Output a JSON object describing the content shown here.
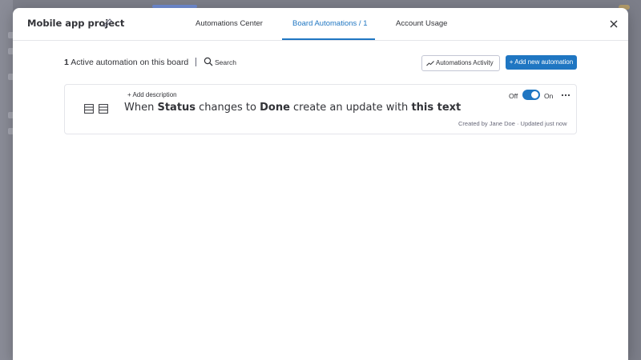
{
  "window": {
    "title": "Mobile app project"
  },
  "tabs": [
    {
      "label": "Automations Center",
      "active": false
    },
    {
      "label": "Board Automations / 1",
      "active": true
    },
    {
      "label": "Account Usage",
      "active": false
    }
  ],
  "toolbar": {
    "count": "1",
    "count_suffix": "Active automation on this board",
    "search_label": "Search",
    "activity_label": "Automations Activity",
    "add_label": "+ Add new automation"
  },
  "automation": {
    "add_description": "+ Add description",
    "sentence": [
      {
        "text": "When ",
        "strong": false
      },
      {
        "text": "Status",
        "strong": true
      },
      {
        "text": " changes to ",
        "strong": false
      },
      {
        "text": "Done",
        "strong": true
      },
      {
        "text": " create an update with ",
        "strong": false
      },
      {
        "text": "this text",
        "strong": true
      }
    ],
    "toggle_off_label": "Off",
    "toggle_on_label": "On",
    "toggle_state": "on",
    "meta": "Created by Jane Doe · Updated just now",
    "icons": [
      "board-icon",
      "board-icon"
    ]
  },
  "colors": {
    "accent": "#1f76c2",
    "text": "#323338",
    "muted": "#676879",
    "border": "#e4e5ea"
  }
}
